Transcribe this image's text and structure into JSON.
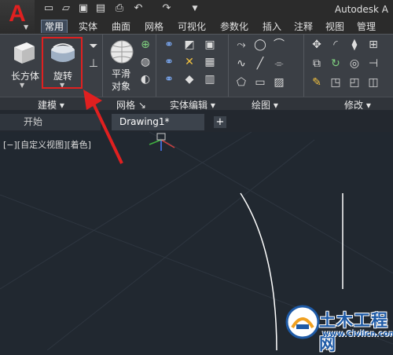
{
  "app": {
    "title": "Autodesk A",
    "logo_letter": "A"
  },
  "quick_access": [
    {
      "name": "new-icon",
      "glyph": "▭"
    },
    {
      "name": "open-icon",
      "glyph": "▱"
    },
    {
      "name": "save-icon",
      "glyph": "▣"
    },
    {
      "name": "saveas-icon",
      "glyph": "▤"
    },
    {
      "name": "print-icon",
      "glyph": "⎙"
    },
    {
      "name": "undo-icon",
      "glyph": "↶"
    },
    {
      "name": "redo-icon",
      "glyph": "↷"
    }
  ],
  "ribbon_tabs": [
    "常用",
    "实体",
    "曲面",
    "网格",
    "可视化",
    "参数化",
    "插入",
    "注释",
    "视图",
    "管理"
  ],
  "ribbon_panels": {
    "modeling": {
      "label": "建模",
      "box_label": "长方体",
      "revolve_label": "旋转"
    },
    "mesh": {
      "label": "网格",
      "smooth_label_1": "平滑",
      "smooth_label_2": "对象"
    },
    "solid_edit": {
      "label": "实体编辑"
    },
    "draw": {
      "label": "绘图"
    },
    "modify": {
      "label": "修改"
    }
  },
  "file_tabs": {
    "start": "开始",
    "drawing": "Drawing1*",
    "add": "+"
  },
  "viewport": {
    "label": "[−][自定义视图][着色]"
  },
  "watermark": {
    "title": "土木工程网",
    "url": "www.Civilcn.com"
  },
  "colors": {
    "accent_red": "#e02020",
    "ribbon_bg": "#3b3f45",
    "viewport_bg": "#212830"
  }
}
